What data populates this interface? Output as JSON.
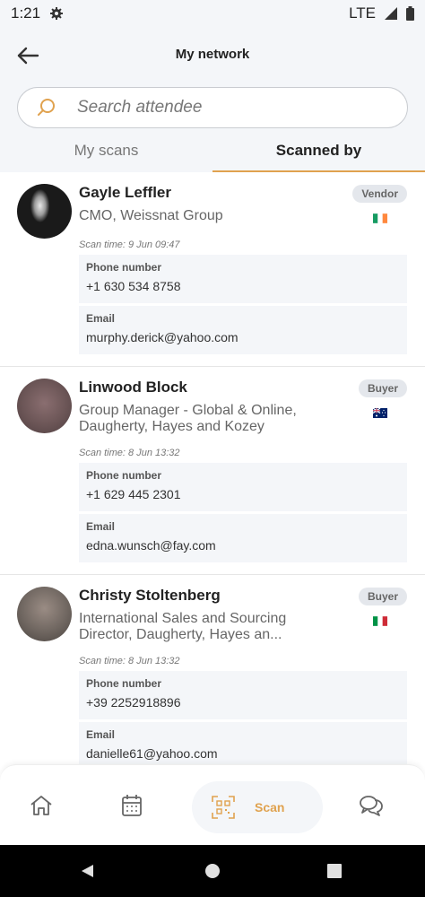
{
  "status_bar": {
    "time": "1:21",
    "network": "LTE"
  },
  "header": {
    "title": "My network"
  },
  "search": {
    "placeholder": "Search attendee"
  },
  "tabs": [
    {
      "label": "My scans",
      "active": false
    },
    {
      "label": "Scanned by",
      "active": true
    }
  ],
  "contacts": [
    {
      "name": "Gayle Leffler",
      "role": "CMO, Weissnat Group",
      "badge": "Vendor",
      "flag": "Ireland",
      "scan_time": "Scan time: 9 Jun 09:47",
      "phone_label": "Phone number",
      "phone": "+1 630 534 8758",
      "email_label": "Email",
      "email": "murphy.derick@yahoo.com"
    },
    {
      "name": "Linwood Block",
      "role": "Group Manager - Global & Online, Daugherty, Hayes and Kozey",
      "badge": "Buyer",
      "flag": "Australia",
      "scan_time": "Scan time: 8 Jun 13:32",
      "phone_label": "Phone number",
      "phone": "+1 629 445 2301",
      "email_label": "Email",
      "email": "edna.wunsch@fay.com"
    },
    {
      "name": "Christy Stoltenberg",
      "role": "International Sales and Sourcing Director, Daugherty, Hayes an...",
      "badge": "Buyer",
      "flag": "Italy",
      "scan_time": "Scan time: 8 Jun 13:32",
      "phone_label": "Phone number",
      "phone": "+39 2252918896",
      "email_label": "Email",
      "email": "danielle61@yahoo.com"
    }
  ],
  "bottom_nav": {
    "scan_label": "Scan"
  },
  "colors": {
    "accent": "#e0a24f",
    "header_bg": "#f4f6f9",
    "badge_bg": "#e4e7ec"
  }
}
